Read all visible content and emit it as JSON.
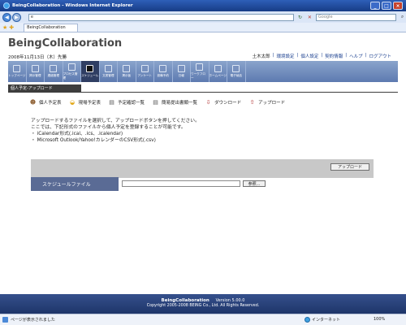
{
  "window": {
    "title": "BeingCollaboration - Windows Internet Explorer",
    "url": "e",
    "search_placeholder": "Google",
    "tab_label": "BeingCollaboration",
    "controls": [
      "_",
      "□",
      "×"
    ]
  },
  "header": {
    "brand": "BeingCollaboration",
    "date": "2008年11月13日（木）先勝",
    "user": "土木太郎",
    "links": [
      "環境設定",
      "個人設定",
      "契約情報",
      "ヘルプ",
      "ログアウト"
    ]
  },
  "nav": [
    {
      "label": "トップページ",
      "active": false
    },
    {
      "label": "掲示管理",
      "active": false
    },
    {
      "label": "連絡管理",
      "active": false
    },
    {
      "label": "プロセス管理",
      "active": false
    },
    {
      "label": "スケジュール",
      "active": true
    },
    {
      "label": "文書管理",
      "active": false
    },
    {
      "label": "掲示板",
      "active": false
    },
    {
      "label": "アンケート",
      "active": false
    },
    {
      "label": "設備予約",
      "active": false
    },
    {
      "label": "日報",
      "active": false
    },
    {
      "label": "ワークフロー",
      "active": false
    },
    {
      "label": "ホームページ",
      "active": false
    },
    {
      "label": "電子納品",
      "active": false
    }
  ],
  "section": {
    "title": "個人予定-アップロード"
  },
  "subnav": [
    {
      "label": "個人予定表",
      "icon": "person-icon"
    },
    {
      "label": "現場予定表",
      "icon": "helmet-icon"
    },
    {
      "label": "予定確認一覧",
      "icon": "list-icon"
    },
    {
      "label": "簡易提出書類一覧",
      "icon": "document-icon"
    },
    {
      "label": "ダウンロード",
      "icon": "download-icon"
    },
    {
      "label": "アップロード",
      "icon": "upload-icon"
    }
  ],
  "description": {
    "line1": "アップロードするファイルを選択して、アップロードボタンを押してください。",
    "line2": "ここでは、下記形式のファイルから個人予定を登録することが可能です。",
    "bullet1": "・ iCalendar形式(.ical、.ics、.icalendar)",
    "bullet2": "・ Microsoft Outlook/Yahoo!カレンダーのCSV形式(.csv)"
  },
  "form": {
    "upload_button": "アップロード",
    "file_label": "スケジュールファイル",
    "browse_button": "参照..."
  },
  "footer": {
    "product": "BeingCollaboration",
    "version": "Version 5.00.0",
    "copyright": "Copyright 2005-2008 BEING Co., Ltd. All Rights Reserved."
  },
  "status": {
    "text": "ページが表示されました",
    "zone": "インターネット",
    "zoom": "100%"
  }
}
